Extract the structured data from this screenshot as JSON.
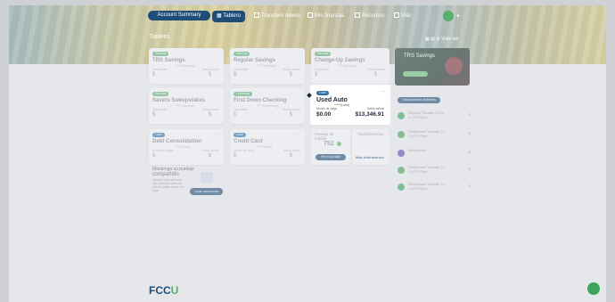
{
  "nav": {
    "account_pill": "Account Summary",
    "tabs": [
      {
        "label": "Tablero"
      },
      {
        "label": "Transferir dinero"
      },
      {
        "label": "Mis finanzas"
      },
      {
        "label": "Recursos"
      },
      {
        "label": "Más"
      }
    ]
  },
  "section_title": "Tablero",
  "view_label": "Vista del",
  "accounts": [
    {
      "badge": "Savings",
      "name": "TRS Savings",
      "number": "*****(Savings)",
      "left_label": "Disponible",
      "left_amount": "$",
      "right_label": "Saldo actual",
      "right_amount": "$"
    },
    {
      "badge": "Savings",
      "name": "Regular Savings",
      "number": "*****(Savings)",
      "left_label": "Disponible",
      "left_amount": "$",
      "right_label": "Saldo actual",
      "right_amount": "$"
    },
    {
      "badge": "Savings",
      "name": "Change-Up Savings",
      "number": "*****(Savings)",
      "left_label": "Disponible",
      "left_amount": "$",
      "right_label": "Saldo actual",
      "right_amount": "$"
    },
    {
      "badge": "Savings",
      "name": "Savers Sweepstakes",
      "number": "*****(Savings)",
      "left_label": "Disponible",
      "left_amount": "$",
      "right_label": "Saldo actual",
      "right_amount": "$"
    },
    {
      "badge": "Checking",
      "name": "First Down Checking",
      "number": "*****(Checking)",
      "left_label": "Disponible",
      "left_amount": "$",
      "right_label": "Saldo actual",
      "right_amount": "$"
    },
    {
      "badge": "Loan",
      "name": "Debt Consolidation",
      "number": "*****(Loan)",
      "left_label": "Monto de pago",
      "left_amount": "$",
      "right_label": "Saldo actual",
      "right_amount": "$"
    },
    {
      "badge": "Loan",
      "name": "Credit Card",
      "number": "*****(Loan)",
      "left_label": "Monto de pago",
      "left_amount": "$",
      "right_label": "Saldo actual",
      "right_amount": "$"
    }
  ],
  "highlight": {
    "badge": "Loan",
    "name": "Used Auto",
    "number": "*****(Loan)",
    "left_label": "Monto de pago",
    "left_amount": "$0.00",
    "right_label": "Saldo actual",
    "right_amount": "$13,346.91"
  },
  "score_card": {
    "title": "Puntaje de crédito",
    "score": "752",
    "button": "Ver mi puntaje"
  },
  "transfer_card": {
    "title": "Transferencias",
    "link": "Más información"
  },
  "compare_card": {
    "title": "Mantenga su puntaje",
    "title2": "compartido",
    "body": "Agregue una cuenta de otra institución para ver todo su dinero en un solo lugar.",
    "button": "Crear una cuenta"
  },
  "promo": {
    "title": "TRS Savings"
  },
  "side_button": "Transacciones recientes",
  "transactions": [
    {
      "desc": "Deposit Transfer From 1.1275 Savi...",
      "amount": "$"
    },
    {
      "desc": "Withdrawal Transfer To 1.1276 Savi...",
      "amount": "$"
    },
    {
      "desc": "Withdrawal",
      "amount": "$"
    },
    {
      "desc": "Withdrawal Transfer To 1.1275 Savi...",
      "amount": "$"
    },
    {
      "desc": "Withdrawal Transfer To 1.1275 Savi...",
      "amount": "$"
    }
  ],
  "footer_logo": {
    "main": "FCC",
    "accent": "U"
  }
}
